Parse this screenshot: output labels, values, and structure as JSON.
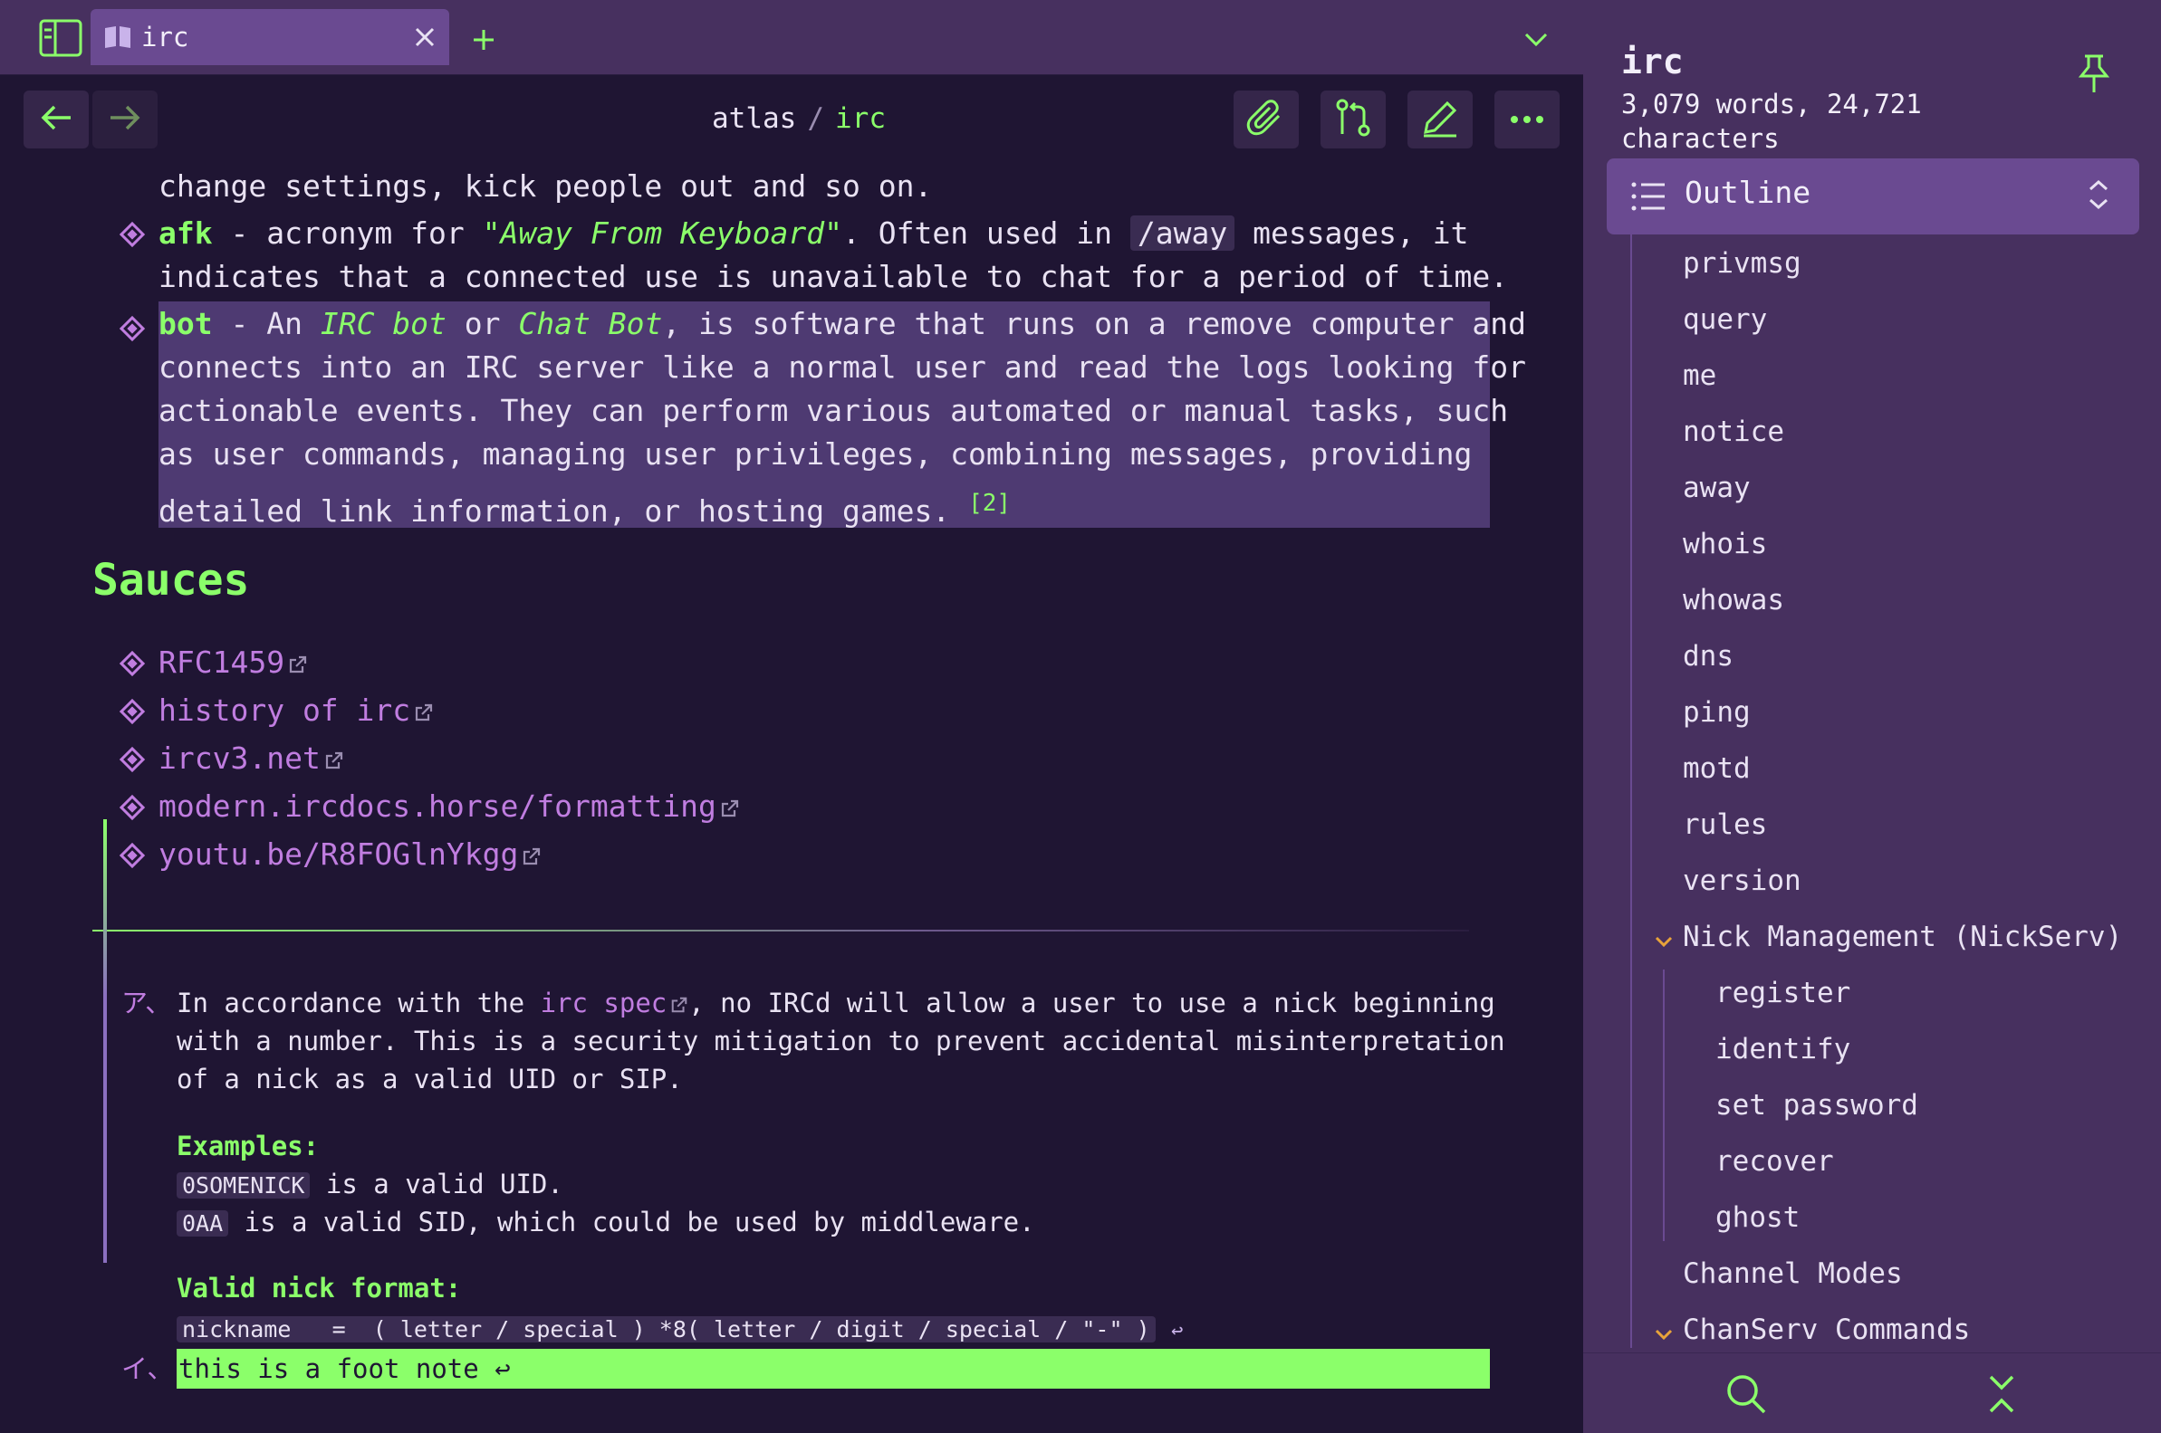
{
  "tab": {
    "title": "irc"
  },
  "breadcrumb": {
    "folder": "atlas",
    "separator": "/",
    "file": "irc"
  },
  "content": {
    "intro_line": "change settings, kick people out and so on.",
    "afk": {
      "term": "afk",
      "dash": " - acronym for ",
      "quote": "\"Away From Keyboard\"",
      "rest1": ". Often used in ",
      "code": "/away",
      "rest2": " messages, it",
      "line2": "indicates that a connected use is unavailable to chat for a period of time."
    },
    "bot": {
      "term": "bot",
      "seg1": " - An ",
      "it1": "IRC bot",
      "seg2": " or ",
      "it2": "Chat Bot",
      "seg3": ", is software that runs on a remove computer and",
      "line2": "connects into an IRC server like a normal user and read the logs looking for",
      "line3": "actionable events. They can perform various automated or manual tasks, such",
      "line4": "as user commands, managing user privileges, combining messages, providing",
      "line5": "detailed link information, or hosting games.",
      "footref": "[2]"
    },
    "sauces_heading": "Sauces",
    "links": [
      "RFC1459",
      "history of irc",
      "ircv3.net",
      "modern.ircdocs.horse/formatting",
      "youtu.be/R8FOGlnYkgg"
    ]
  },
  "footnotes": {
    "fn1": {
      "marker": "ア、",
      "seg1": "In accordance with the ",
      "link": "irc spec",
      "seg2": ", no IRCd will allow a user to use a nick beginning",
      "line2": "with a number. This is a security mitigation to prevent accidental misinterpretation",
      "line3": "of a nick as a valid UID or SIP.",
      "examples_label": "Examples:",
      "ex1_code": "0SOMENICK",
      "ex1_text": " is a valid UID.",
      "ex2_code": "0AA",
      "ex2_text": " is a valid SID, which could be used by middleware.",
      "format_label": "Valid nick format:",
      "format_code": "nickname   =  ( letter / special ) *8( letter / digit / special / \"-\" )",
      "return": "↩"
    },
    "fn2": {
      "marker": "イ、",
      "text": "this is a foot note ↩"
    }
  },
  "panel": {
    "title": "irc",
    "stats": "3,079 words, 24,721 characters",
    "outline_label": "Outline",
    "outline_items": [
      "privmsg",
      "query",
      "me",
      "notice",
      "away",
      "whois",
      "whowas",
      "dns",
      "ping",
      "motd",
      "rules",
      "version"
    ],
    "nick_section": "Nick Management (NickServ)",
    "nick_items": [
      "register",
      "identify",
      "set password",
      "recover",
      "ghost"
    ],
    "channel_modes": "Channel Modes",
    "chanserv": "ChanServ Commands"
  },
  "colors": {
    "accent_green": "#8bff6a",
    "accent_purple": "#c07de0",
    "bg": "#1f1533",
    "panel": "#47305f"
  }
}
